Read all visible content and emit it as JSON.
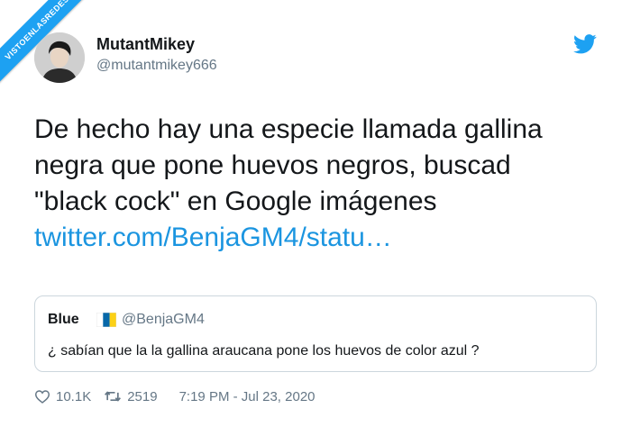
{
  "watermark": {
    "text": "VISTOENLASREDES"
  },
  "author": {
    "name": "MutantMikey",
    "handle": "@mutantmikey666",
    "avatar_icon": "profile-photo"
  },
  "tweet": {
    "lines": [
      "De hecho hay una especie llamada gallina",
      "negra que pone huevos negros, buscad",
      "\"black cock\" en Google imágenes"
    ],
    "link": "twitter.com/BenjaGM4/statu…"
  },
  "quoted": {
    "name": "Blue",
    "flag_icon": "canary-islands-flag",
    "handle": "@BenjaGM4",
    "text": "¿ sabían que la la gallina araucana pone los huevos de color azul ?"
  },
  "meta": {
    "likes": "10.1K",
    "retweets": "2519",
    "timestamp": "7:19 PM - Jul 23, 2020"
  },
  "colors": {
    "twitter_blue": "#1da1f2",
    "link": "#1b95e0",
    "secondary_text": "#657786",
    "border": "#ccd6dd"
  }
}
